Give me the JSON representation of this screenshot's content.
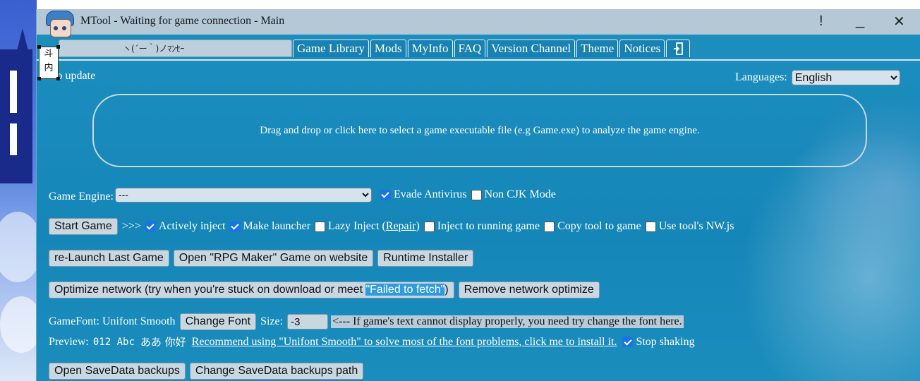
{
  "window": {
    "title": "MTool - Waiting for game connection - Main",
    "controls": {
      "info": "!",
      "minimize": "_",
      "close": "✕"
    }
  },
  "mascot_box_text": "斗\n内",
  "tabs": {
    "marquee_text": "ヽ(´ー｀)ノﾏﾝｾｰ",
    "items": [
      {
        "label": "Game Library"
      },
      {
        "label": "Mods"
      },
      {
        "label": "MyInfo"
      },
      {
        "label": "FAQ"
      },
      {
        "label": "Version Channel"
      },
      {
        "label": "Theme"
      },
      {
        "label": "Notices"
      }
    ],
    "exit_icon": "exit-door-icon"
  },
  "status": {
    "update_text": "No update"
  },
  "languages": {
    "label": "Languages:",
    "selected": "English"
  },
  "dropzone": {
    "text": "Drag and drop or click here to select a game executable file (e.g Game.exe) to analyze the game engine."
  },
  "engine": {
    "label": "Game Engine:",
    "selected": "---",
    "evade_antivirus": {
      "label": "Evade Antivirus",
      "checked": true
    },
    "non_cjk": {
      "label": "Non CJK Mode",
      "checked": false
    }
  },
  "start_row": {
    "start_label": "Start Game",
    "arrow": ">>>",
    "actively_inject": {
      "label": "Actively inject",
      "checked": true
    },
    "make_launcher": {
      "label": "Make launcher",
      "checked": true
    },
    "lazy_inject": {
      "label": "Lazy Inject (",
      "repair": "Repair",
      "close": ")",
      "checked": false
    },
    "inject_running": {
      "label": "Inject to running game",
      "checked": false
    },
    "copy_tool": {
      "label": "Copy tool to game",
      "checked": false
    },
    "use_nwjs": {
      "label": "Use tool's NW.js",
      "checked": false
    }
  },
  "launch_row": {
    "relaunch": "re-Launch Last Game",
    "open_rpg": "Open \"RPG Maker\" Game on website",
    "runtime": "Runtime Installer"
  },
  "network_row": {
    "optimize_prefix": "Optimize network (try when you're stuck on download or meet ",
    "optimize_highlight": "\"Failed to fetch\"",
    "optimize_suffix": ")",
    "remove": "Remove network optimize"
  },
  "font_row": {
    "label": "GameFont: Unifont Smooth",
    "change_font": "Change Font",
    "size_label": "Size:",
    "size_value": "-3",
    "hint": "<--- If game's text cannot display properly, you need try change the font here."
  },
  "preview_row": {
    "label": "Preview:",
    "sample_mono": "012 Abc",
    "sample_cjk": "ああ 你好",
    "recommend_link": "Recommend using \"Unifont Smooth\" to solve most of the font problems, click me to install it.",
    "stop_shaking": {
      "label": "Stop shaking",
      "checked": true
    }
  },
  "backup_row": {
    "open_backups": "Open SaveData backups",
    "change_path": "Change SaveData backups path"
  }
}
